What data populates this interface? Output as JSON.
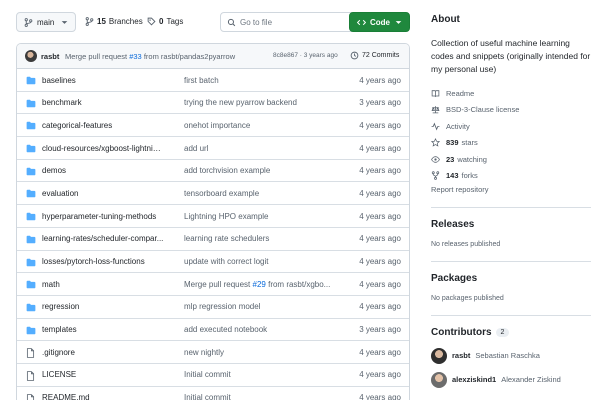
{
  "toolbar": {
    "branch": "main",
    "branches_count": "15",
    "branches_label": "Branches",
    "tags_count": "0",
    "tags_label": "Tags",
    "goto_placeholder": "Go to file",
    "code_label": "Code"
  },
  "commit": {
    "user": "rasbt",
    "message_prefix": "Merge pull request",
    "pr": "#33",
    "message_suffix": "from rasbt/pandas2pyarrow",
    "hash": "8c8e867",
    "age": "3 years ago",
    "count": "72 Commits"
  },
  "files": [
    {
      "type": "folder",
      "name": "baselines",
      "message": "first batch",
      "age": "4 years ago"
    },
    {
      "type": "folder",
      "name": "benchmark",
      "message": "trying the new pyarrow backend",
      "age": "3 years ago"
    },
    {
      "type": "folder",
      "name": "categorical-features",
      "message": "onehot importance",
      "age": "4 years ago"
    },
    {
      "type": "folder",
      "name": "cloud-resources/xgboost-lightning...",
      "message": "add url",
      "age": "4 years ago"
    },
    {
      "type": "folder",
      "name": "demos",
      "message": "add torchvision example",
      "age": "4 years ago"
    },
    {
      "type": "folder",
      "name": "evaluation",
      "message": "tensorboard example",
      "age": "4 years ago"
    },
    {
      "type": "folder",
      "name": "hyperparameter-tuning-methods",
      "message": "Lightning HPO example",
      "age": "4 years ago"
    },
    {
      "type": "folder",
      "name": "learning-rates/scheduler-compar...",
      "message": "learning rate schedulers",
      "age": "4 years ago"
    },
    {
      "type": "folder",
      "name": "losses/pytorch-loss-functions",
      "message": "update with correct logit",
      "age": "4 years ago"
    },
    {
      "type": "folder",
      "name": "math",
      "message_prefix": "Merge pull request",
      "message_link": "#29",
      "message_suffix": "from rasbt/xgbo...",
      "age": "4 years ago"
    },
    {
      "type": "folder",
      "name": "regression",
      "message": "mlp regression model",
      "age": "4 years ago"
    },
    {
      "type": "folder",
      "name": "templates",
      "message": "add executed notebook",
      "age": "3 years ago"
    },
    {
      "type": "file",
      "name": ".gitignore",
      "message": "new nightly",
      "age": "4 years ago"
    },
    {
      "type": "file",
      "name": "LICENSE",
      "message": "Initial commit",
      "age": "4 years ago"
    },
    {
      "type": "file",
      "name": "README.md",
      "message": "Initial commit",
      "age": "4 years ago"
    }
  ],
  "about": {
    "heading": "About",
    "description": "Collection of useful machine learning codes and snippets (originally intended for my personal use)",
    "readme": "Readme",
    "license": "BSD-3-Clause license",
    "activity": "Activity",
    "stars_count": "839",
    "stars_label": "stars",
    "watching_count": "23",
    "watching_label": "watching",
    "forks_count": "143",
    "forks_label": "forks",
    "report": "Report repository"
  },
  "releases": {
    "heading": "Releases",
    "empty": "No releases published"
  },
  "packages": {
    "heading": "Packages",
    "empty": "No packages published"
  },
  "contributors": {
    "heading": "Contributors",
    "count": "2",
    "list": [
      {
        "login": "rasbt",
        "name": "Sebastian Raschka"
      },
      {
        "login": "alexziskind1",
        "name": "Alexander Ziskind"
      }
    ]
  },
  "colors": {
    "accent": "#0969da",
    "primary_button": "#1f883d",
    "folder": "#54aeff",
    "muted": "#59636e",
    "border": "#d0d7de"
  },
  "icons": {
    "branch": "git-branch-icon",
    "tag": "tag-icon",
    "search": "search-icon",
    "code": "code-icon",
    "history": "history-icon",
    "folder": "folder-icon",
    "file": "file-icon"
  }
}
